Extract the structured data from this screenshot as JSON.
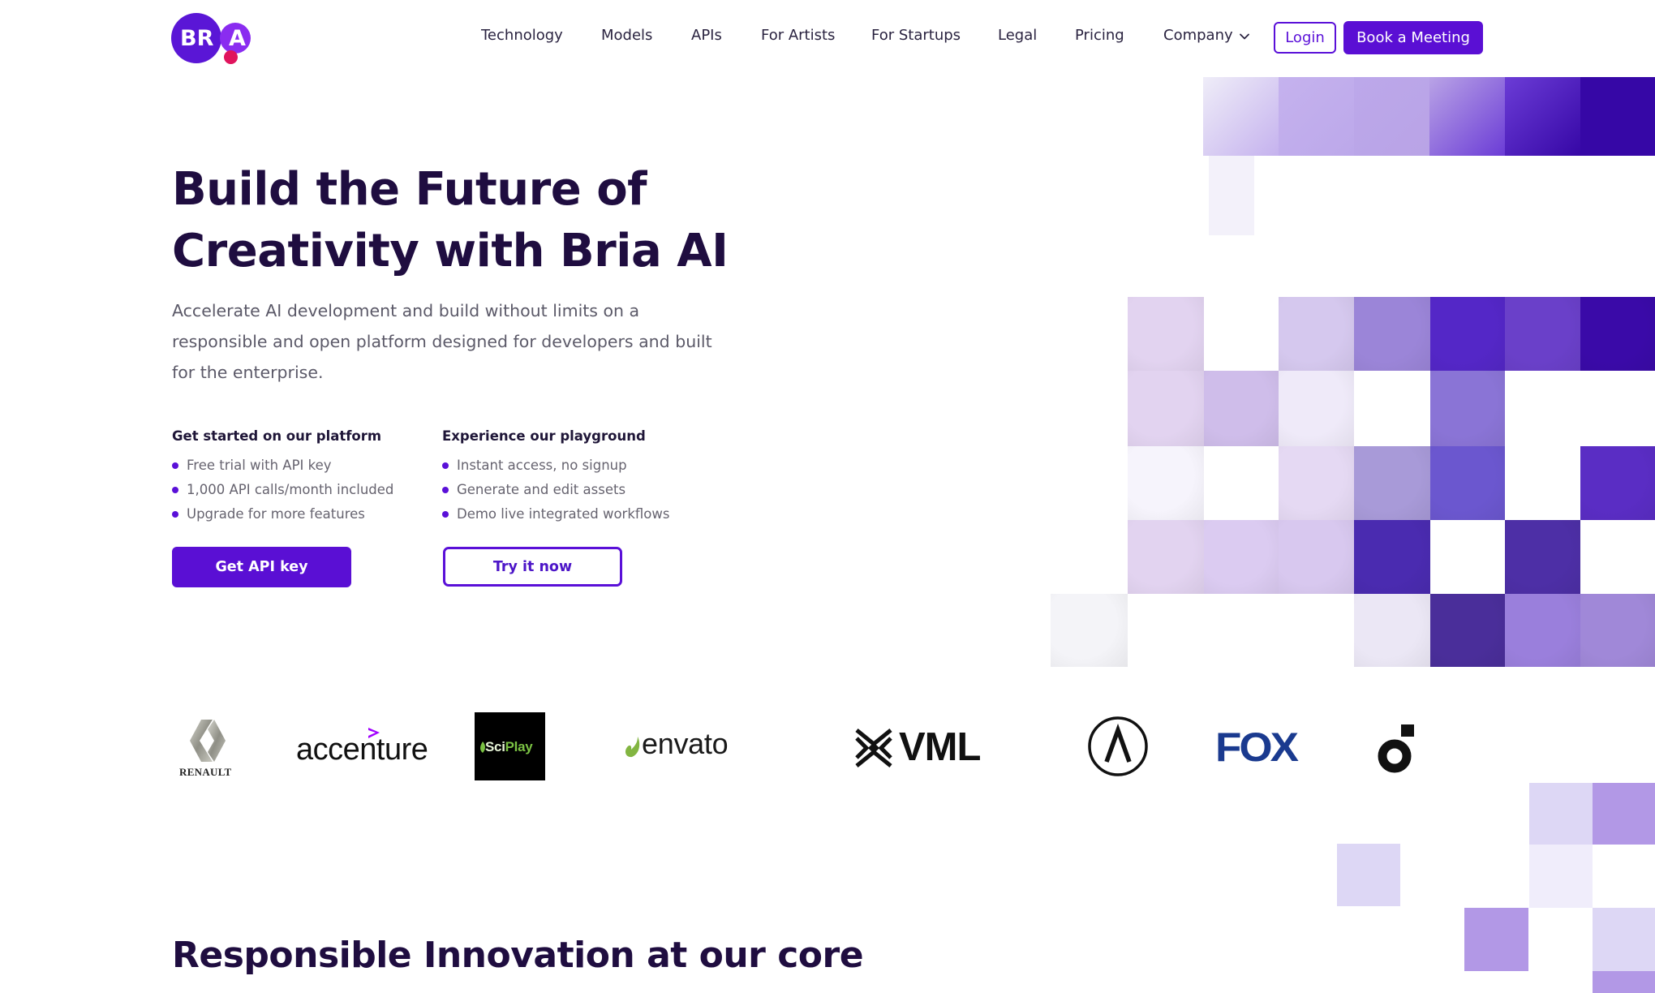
{
  "brand": {
    "logo_text_left": "BR",
    "logo_text_right": "A",
    "name": "BRIA",
    "accent_color": "#5a0fd4",
    "dot_color": "#e0145d"
  },
  "nav": {
    "items": [
      {
        "label": "Technology"
      },
      {
        "label": "Models"
      },
      {
        "label": "APIs"
      },
      {
        "label": "For Artists"
      },
      {
        "label": "For Startups"
      },
      {
        "label": "Legal"
      },
      {
        "label": "Pricing"
      },
      {
        "label": "Company",
        "has_dropdown": true
      }
    ],
    "dropdown_icon": "chevron-down-icon",
    "login_label": "Login",
    "book_label": "Book a Meeting"
  },
  "hero": {
    "title_line1": "Build the Future of",
    "title_line2": "Creativity with Bria AI",
    "subtitle": "Accelerate AI development and build without limits on a responsible and open platform designed for developers and built for the enterprise.",
    "platform": {
      "heading": "Get started on our platform",
      "bullets": [
        "Free trial with API key",
        "1,000 API calls/month included",
        "Upgrade for more features"
      ],
      "button_label": "Get API key"
    },
    "playground": {
      "heading": "Experience our playground",
      "bullets": [
        "Instant access, no signup",
        "Generate and edit assets",
        "Demo live integrated workflows"
      ],
      "button_label": "Try it now"
    }
  },
  "mosaic": {
    "description": "purple-tinted pixel mosaic of a face and flowers",
    "top_row_colors": [
      "#efedf8",
      "#c5b2ee",
      "#bca8ea",
      "#b9a3e6",
      "#6b3cd6",
      "#3607a6"
    ],
    "face_grid": [
      [
        "",
        "#e2d3f0",
        "",
        "#d5c8ee",
        "#9b85d8",
        "#5427c7",
        "#6a40c9",
        "#3a0aa8"
      ],
      [
        "",
        "#e2d3f0",
        "#cfbdea",
        "#efeaf9",
        "",
        "#8a74d6",
        "",
        ""
      ],
      [
        "",
        "#f6f4fc",
        "",
        "#e5d9f3",
        "#a89ad8",
        "#6b57cf",
        "",
        "#5a2dc4"
      ],
      [
        "",
        "#e2d3f0",
        "#dbcbf1",
        "#d8c8ef",
        "#4a2bb0",
        "",
        "#4d2fa6",
        ""
      ],
      [
        "#f4f4f8",
        "",
        "",
        "",
        "#ebe7f5",
        "#4a2e9a",
        "#9a7fdc",
        "#a088d8"
      ]
    ],
    "lower_squares": [
      {
        "color": "#ddd7f5"
      },
      {
        "color": "#ddd7f5"
      },
      {
        "color": "#b298e6"
      },
      {
        "color": "#f0edfb"
      },
      {
        "color": "#b298e6"
      },
      {
        "color": "#ddd7f5"
      },
      {
        "color": "#b298e6"
      }
    ]
  },
  "logos": {
    "items": [
      {
        "name": "Renault",
        "text": "RENAULT"
      },
      {
        "name": "Accenture",
        "text": "accenture"
      },
      {
        "name": "SciPlay",
        "text_a": "Sci",
        "text_b": "Play"
      },
      {
        "name": "Envato",
        "text": "envato"
      },
      {
        "name": "VML",
        "text": "VML"
      },
      {
        "name": "Lambda-circle logo"
      },
      {
        "name": "FOX",
        "text": "FOX"
      },
      {
        "name": "Ring-and-square logo"
      }
    ]
  },
  "section": {
    "title": "Responsible Innovation at our core"
  }
}
